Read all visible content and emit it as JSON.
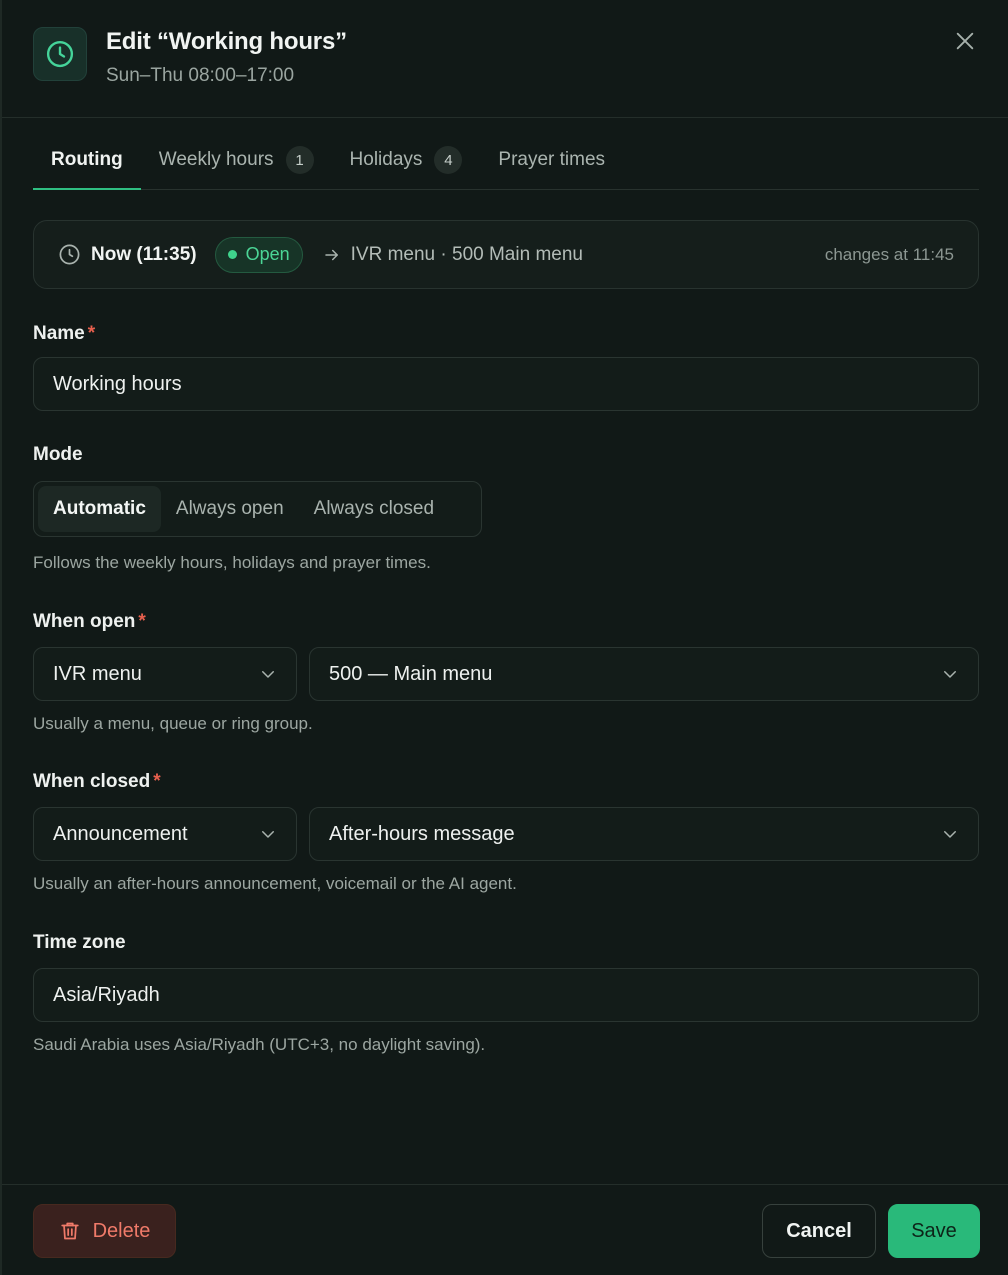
{
  "header": {
    "title": "Edit “Working hours”",
    "subtitle": "Sun–Thu 08:00–17:00",
    "icon": "clock-icon",
    "close_icon": "close-icon"
  },
  "tabs": [
    {
      "label": "Routing",
      "active": true,
      "badge": null
    },
    {
      "label": "Weekly hours",
      "active": false,
      "badge": "1"
    },
    {
      "label": "Holidays",
      "active": false,
      "badge": "4"
    },
    {
      "label": "Prayer times",
      "active": false,
      "badge": null
    }
  ],
  "status": {
    "now_label": "Now (11:35)",
    "state": "Open",
    "route": "IVR menu · 500 Main menu",
    "changes": "changes at 11:45"
  },
  "form": {
    "name": {
      "label": "Name",
      "required_mark": "*",
      "value": "Working hours"
    },
    "mode": {
      "label": "Mode",
      "options": [
        "Automatic",
        "Always open",
        "Always closed"
      ],
      "selected": "Automatic",
      "help": "Follows the weekly hours, holidays and prayer times."
    },
    "when_open": {
      "label": "When open",
      "required_mark": "*",
      "type_value": "IVR menu",
      "target_value": "500 — Main menu",
      "help": "Usually a menu, queue or ring group."
    },
    "when_closed": {
      "label": "When closed",
      "required_mark": "*",
      "type_value": "Announcement",
      "target_value": "After-hours message",
      "help": "Usually an after-hours announcement, voicemail or the AI agent."
    },
    "time_zone": {
      "label": "Time zone",
      "value": "Asia/Riyadh",
      "help": "Saudi Arabia uses Asia/Riyadh (UTC+3, no daylight saving)."
    }
  },
  "footer": {
    "delete_label": "Delete",
    "cancel_label": "Cancel",
    "save_label": "Save"
  },
  "colors": {
    "accent": "#2fbf82",
    "open_green": "#4bd596",
    "danger": "#ef7a69",
    "required": "#e8604e",
    "background": "#111917"
  }
}
